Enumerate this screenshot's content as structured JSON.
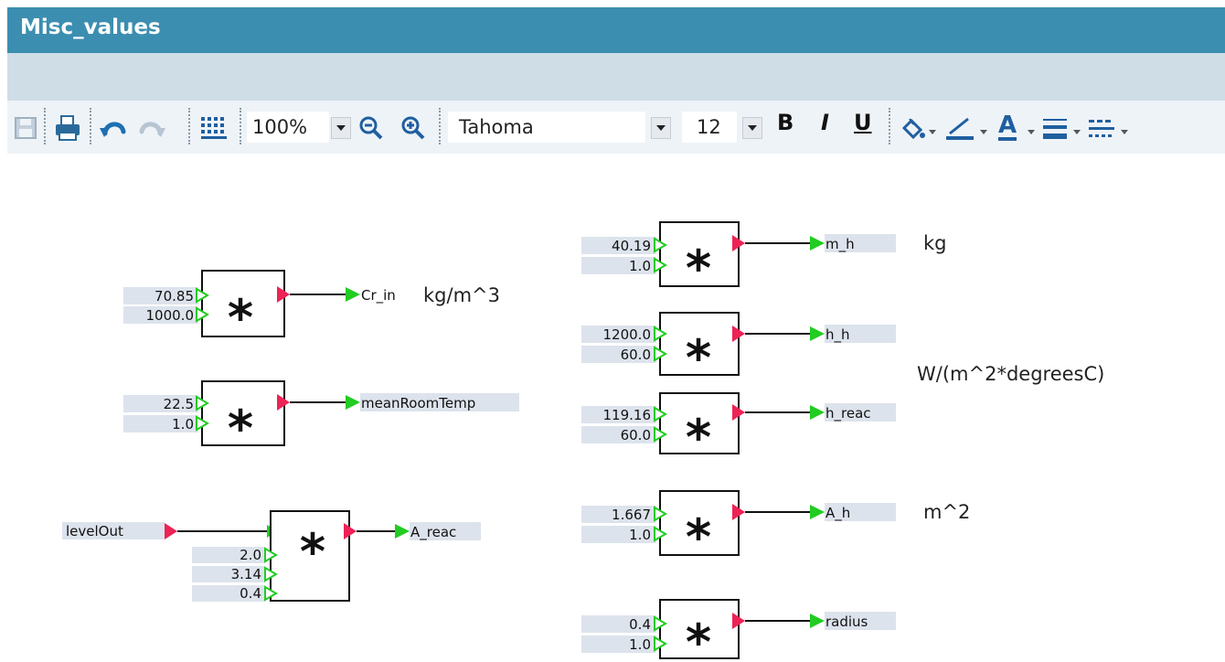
{
  "window": {
    "title": "Misc_values"
  },
  "toolbar": {
    "zoom": "100%",
    "font_name": "Tahoma",
    "font_size": "12",
    "bold_label": "B",
    "italic_label": "I",
    "underline_label": "U",
    "font_color_label": "A",
    "icons": [
      "save-icon",
      "print-icon",
      "undo-icon",
      "redo-icon",
      "grid-icon",
      "zoom-out-icon",
      "zoom-in-icon",
      "fill-color-icon",
      "line-color-icon",
      "font-color-icon",
      "line-weight-icon",
      "line-style-icon"
    ]
  },
  "blocks": {
    "cr_in": {
      "op": "*",
      "inputs": [
        "70.85",
        "1000.0"
      ],
      "output": "Cr_in"
    },
    "room_temp": {
      "op": "*",
      "inputs": [
        "22.5",
        "1.0"
      ],
      "output": "meanRoomTemp"
    },
    "a_reac": {
      "op": "*",
      "signal_in": "levelOut",
      "inputs": [
        "2.0",
        "3.14",
        "0.4"
      ],
      "output": "A_reac"
    },
    "m_h": {
      "op": "*",
      "inputs": [
        "40.19",
        "1.0"
      ],
      "output": "m_h"
    },
    "h_h": {
      "op": "*",
      "inputs": [
        "1200.0",
        "60.0"
      ],
      "output": "h_h"
    },
    "h_reac": {
      "op": "*",
      "inputs": [
        "119.16",
        "60.0"
      ],
      "output": "h_reac"
    },
    "a_h": {
      "op": "*",
      "inputs": [
        "1.667",
        "1.0"
      ],
      "output": "A_h"
    },
    "radius": {
      "op": "*",
      "inputs": [
        "0.4",
        "1.0"
      ],
      "output": "radius"
    }
  },
  "annotations": {
    "cr_in_unit": "kg/m^3",
    "m_h_unit": "kg",
    "h_unit": "W/(m^2*degreesC)",
    "a_h_unit": "m^2"
  },
  "colors": {
    "title_bar": "#3c8eb0",
    "input_port": "#22cc22",
    "output_port": "#ee2255",
    "value_box": "#dde3ec"
  }
}
